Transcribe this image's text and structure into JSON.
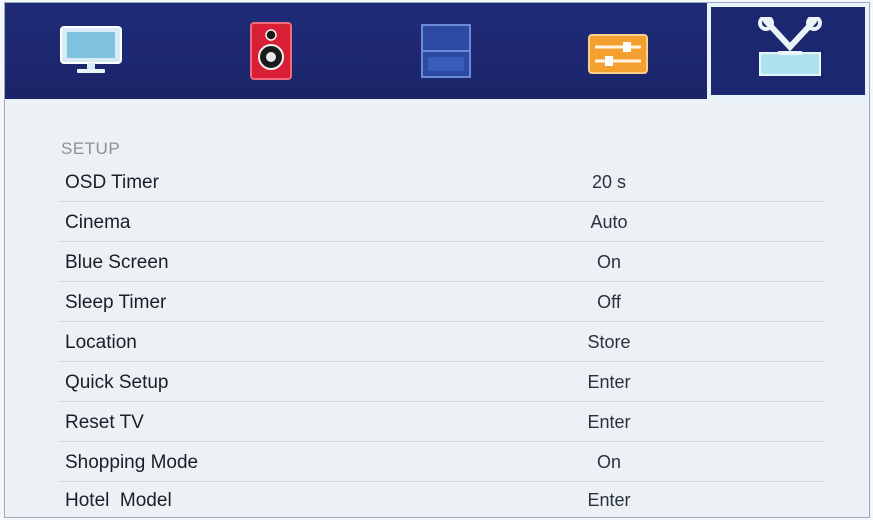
{
  "tabs": [
    {
      "name": "picture",
      "icon": "monitor-icon"
    },
    {
      "name": "sound",
      "icon": "speaker-icon"
    },
    {
      "name": "channel",
      "icon": "channel-icon"
    },
    {
      "name": "features",
      "icon": "sliders-icon"
    },
    {
      "name": "setup",
      "icon": "tools-icon",
      "active": true
    }
  ],
  "setup": {
    "title": "SETUP",
    "items": [
      {
        "label": "OSD Timer",
        "value": "20 s"
      },
      {
        "label": "Cinema",
        "value": "Auto"
      },
      {
        "label": "Blue Screen",
        "value": "On"
      },
      {
        "label": "Sleep Timer",
        "value": "Off"
      },
      {
        "label": "Location",
        "value": "Store"
      },
      {
        "label": "Quick Setup",
        "value": "Enter"
      },
      {
        "label": "Reset TV",
        "value": "Enter"
      },
      {
        "label": "Shopping Mode",
        "value": "On"
      },
      {
        "label": "Hotel  Model",
        "value": "Enter"
      }
    ]
  },
  "colors": {
    "topbar": "#1d2870",
    "panel": "#ebf1f4",
    "active_tab_border": "#e8f3fa"
  }
}
